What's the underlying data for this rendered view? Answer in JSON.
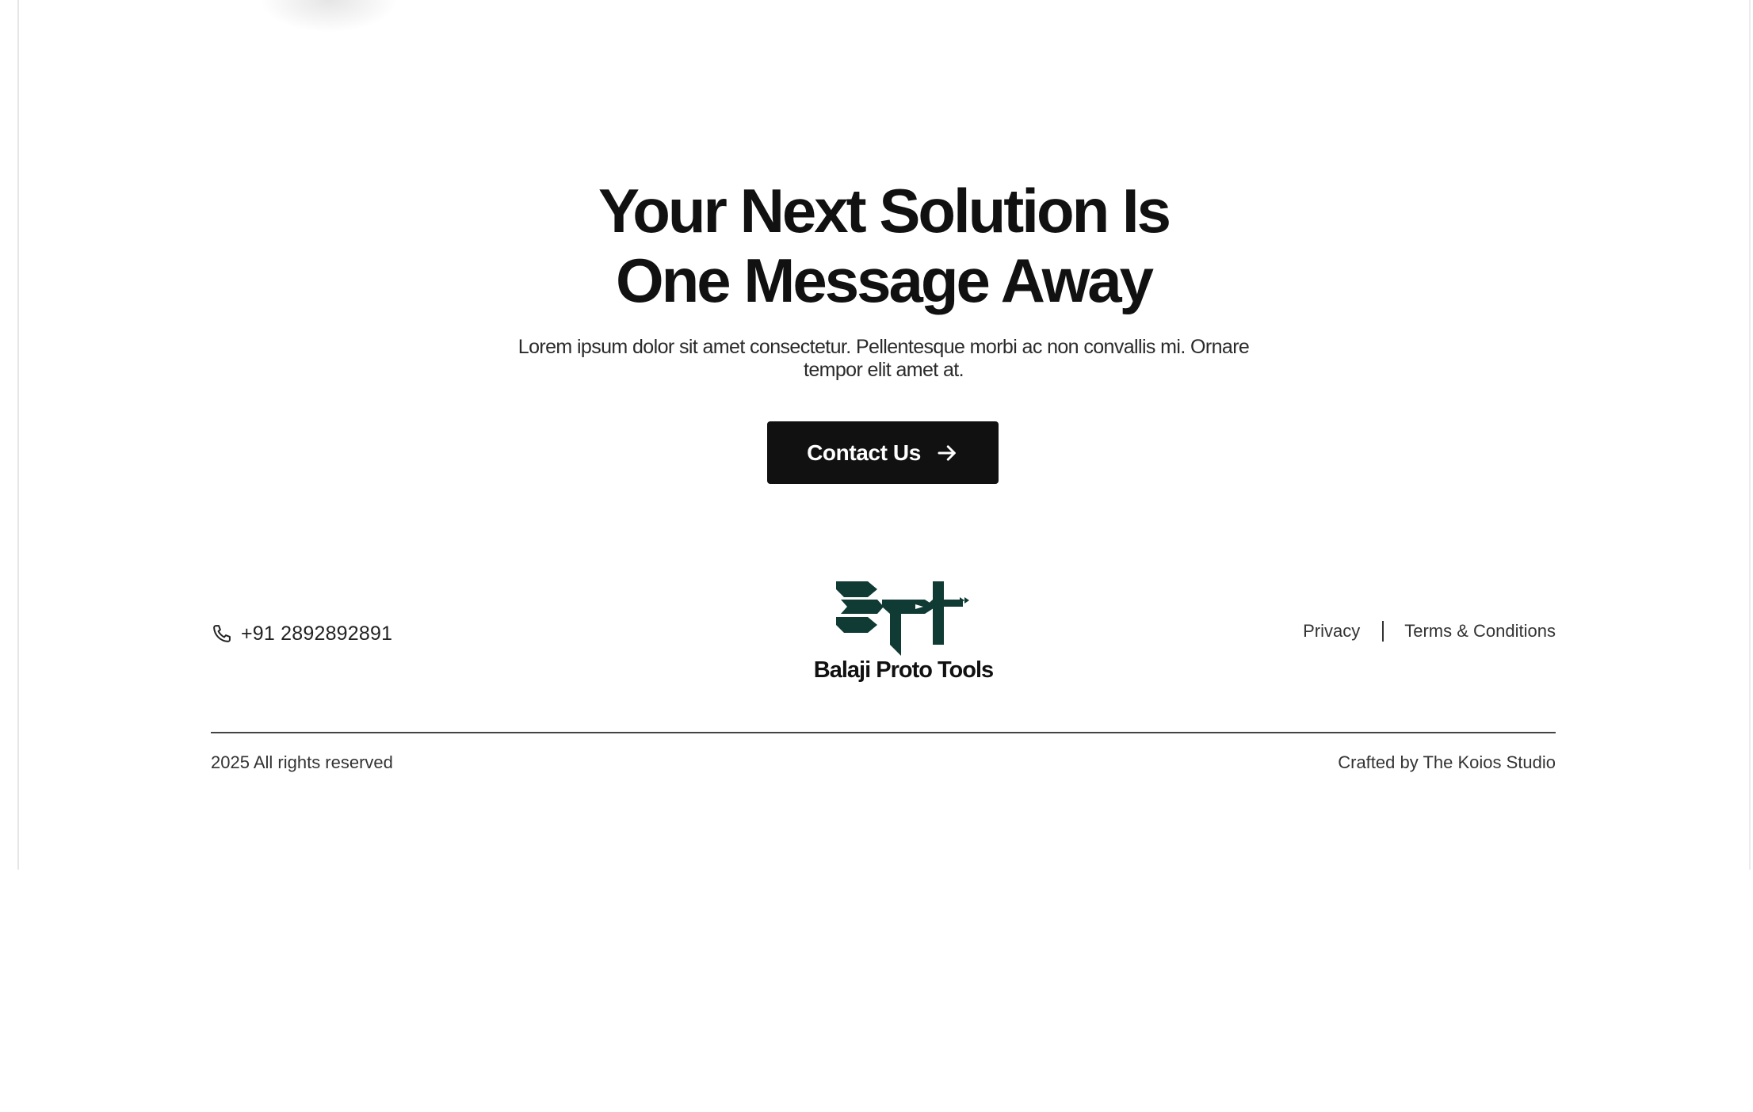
{
  "hero": {
    "title_line1": "Your Next Solution Is",
    "title_line2": "One Message Away",
    "subtitle": "Lorem ipsum dolor sit amet consectetur. Pellentesque morbi ac non convallis mi. Ornare tempor elit amet at.",
    "cta_label": "Contact Us",
    "cta_icon": "arrow-right-icon"
  },
  "footer": {
    "phone": {
      "icon": "phone-icon",
      "number": "+91 2892892891"
    },
    "brand": {
      "name": "Balaji Proto Tools",
      "logo_color": "#0f3b34"
    },
    "links": {
      "privacy": "Privacy",
      "terms": "Terms & Conditions"
    },
    "copyright": "2025 All rights reserved",
    "credit": "Crafted by The Koios Studio"
  },
  "colors": {
    "text": "#111111",
    "button_bg": "#111111",
    "button_text": "#ffffff",
    "logo": "#0f3b34"
  }
}
